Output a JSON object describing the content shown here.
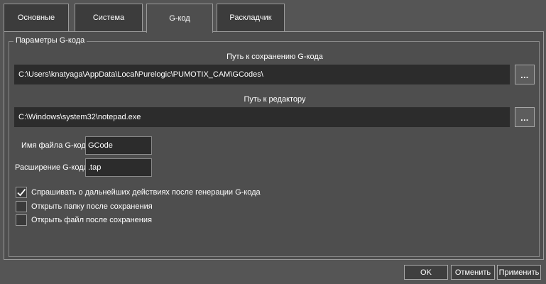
{
  "tabs": [
    {
      "label": "Основные"
    },
    {
      "label": "Система"
    },
    {
      "label": "G-код"
    },
    {
      "label": "Раскладчик"
    }
  ],
  "group": {
    "title": "Параметры G-кода"
  },
  "save_path": {
    "caption": "Путь к сохранению G-кода",
    "value": "C:\\Users\\knatyaga\\AppData\\Local\\Purelogic\\PUMOTIX_CAM\\GCodes\\",
    "browse_label": "..."
  },
  "editor_path": {
    "caption": "Путь к редактору",
    "value": "C:\\Windows\\system32\\notepad.exe",
    "browse_label": "..."
  },
  "filename": {
    "label": "Имя файла G-кода",
    "value": "GCode"
  },
  "extension": {
    "label": "Расширение G-кода",
    "value": ".tap"
  },
  "checkboxes": [
    {
      "label": "Спрашивать о дальнейших действиях после генерации G-кода",
      "checked": true
    },
    {
      "label": "Открыть папку после сохранения",
      "checked": false
    },
    {
      "label": "Открыть файл после сохранения",
      "checked": false
    }
  ],
  "buttons": {
    "ok": "OK",
    "cancel": "Отменить",
    "apply": "Применить"
  }
}
